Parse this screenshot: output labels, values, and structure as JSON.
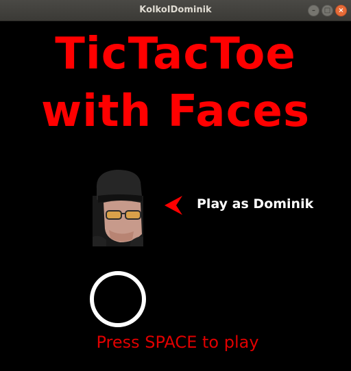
{
  "window": {
    "title": "KolkoIDominik",
    "buttons": [
      "minimize",
      "maximize",
      "close"
    ]
  },
  "game": {
    "title_line1": "TicTacToe",
    "title_line2": "with Faces",
    "player_label": "Play as Dominik",
    "press_prompt": "Press SPACE to play",
    "avatar_icon": "player-face-icon",
    "selector_icon": "arrow-left-icon",
    "opponent_icon": "circle-o-icon"
  },
  "colors": {
    "background": "#000000",
    "title": "#ff0000",
    "prompt": "#e00000",
    "label": "#ffffff",
    "arrow": "#ff0000"
  }
}
